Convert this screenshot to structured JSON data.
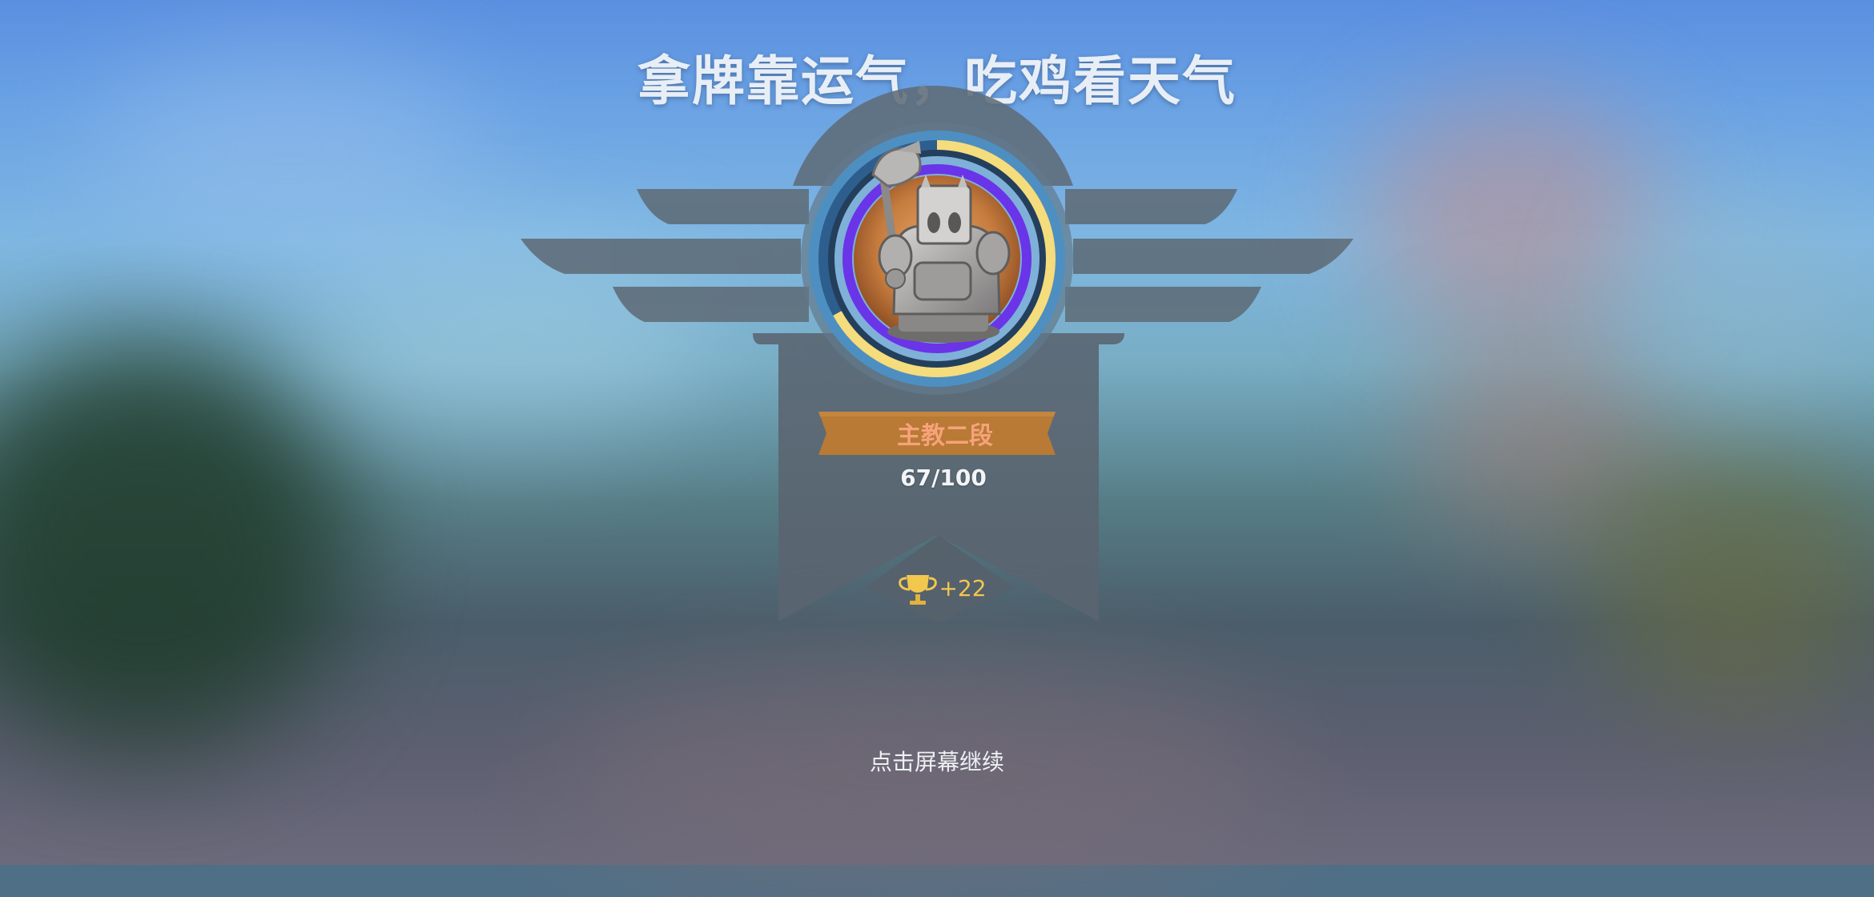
{
  "title": "拿牌靠运气，吃鸡看天气",
  "rank": {
    "name": "主教二段",
    "points_text": "67/100",
    "points": 67,
    "points_max": 100
  },
  "reward": {
    "icon": "trophy-icon",
    "value_text": "+22"
  },
  "hint": "点击屏幕继续",
  "colors": {
    "ring_progress": "#f5dc7c",
    "ring_track": "#2d5e8e",
    "inner_ring": "#6a34e8",
    "ribbon": "#b87a35",
    "rank_text": "#f6a27a",
    "trophy": "#f2c74e"
  }
}
